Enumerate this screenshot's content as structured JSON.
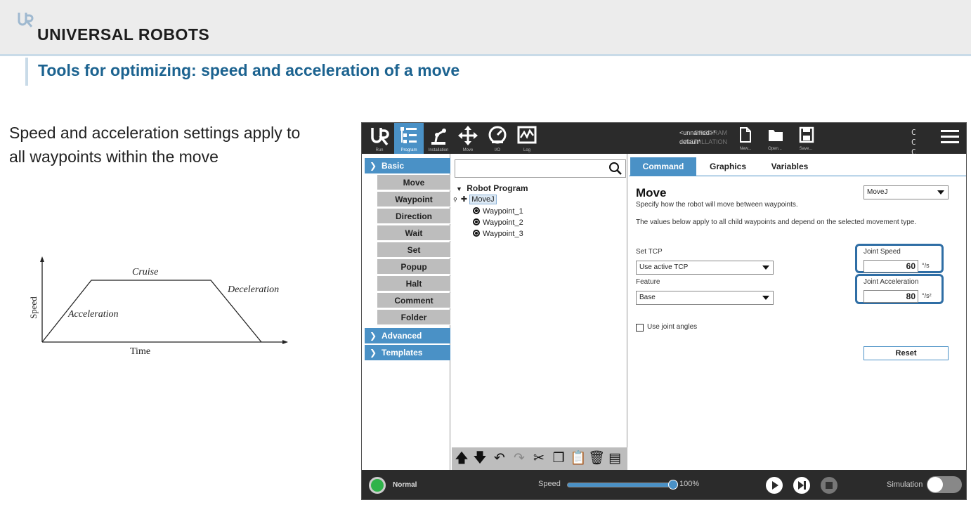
{
  "slide": {
    "brand": "UNIVERSAL ROBOTS",
    "title": "Tools for optimizing: speed and acceleration of a move",
    "intro": "Speed and acceleration settings apply to all waypoints within the move",
    "graph": {
      "ylabel": "Speed",
      "xlabel": "Time",
      "phase_acceleration": "Acceleration",
      "phase_cruise": "Cruise",
      "phase_deceleration": "Deceleration"
    }
  },
  "polyscope": {
    "nav": [
      {
        "label": "Run"
      },
      {
        "label": "Program"
      },
      {
        "label": "Installation"
      },
      {
        "label": "Move"
      },
      {
        "label": "I/O"
      },
      {
        "label": "Log"
      }
    ],
    "program_key": "PROGRAM",
    "installation_key": "INSTALLATION",
    "program_value": "<unnamed>*",
    "installation_value": "default*",
    "file_buttons": [
      {
        "label": "New..."
      },
      {
        "label": "Open..."
      },
      {
        "label": "Save..."
      }
    ],
    "cc_line1": "C C",
    "cc_line2": "C C",
    "menu": {
      "basic": "Basic",
      "items": [
        "Move",
        "Waypoint",
        "Direction",
        "Wait",
        "Set",
        "Popup",
        "Halt",
        "Comment",
        "Folder"
      ],
      "advanced": "Advanced",
      "templates": "Templates"
    },
    "tree": {
      "root": "Robot Program",
      "movej": "MoveJ",
      "waypoints": [
        "Waypoint_1",
        "Waypoint_2",
        "Waypoint_3"
      ]
    },
    "tabs": [
      "Command",
      "Graphics",
      "Variables"
    ],
    "panel": {
      "title": "Move",
      "subtitle": "Specify how the robot will move between waypoints.",
      "description": "The values below apply to all child waypoints and depend on the selected movement type.",
      "move_type": "MoveJ",
      "set_tcp_label": "Set TCP",
      "set_tcp_value": "Use active TCP",
      "feature_label": "Feature",
      "feature_value": "Base",
      "joint_speed_label": "Joint Speed",
      "joint_speed_value": "60",
      "joint_speed_unit": "°/s",
      "joint_accel_label": "Joint Acceleration",
      "joint_accel_value": "80",
      "joint_accel_unit": "°/s²",
      "use_joint_angles": "Use joint angles",
      "reset": "Reset"
    },
    "bottom": {
      "status": "Normal",
      "speed_label": "Speed",
      "speed_value": "100%",
      "speed_fraction": 1.0,
      "simulation": "Simulation"
    }
  }
}
